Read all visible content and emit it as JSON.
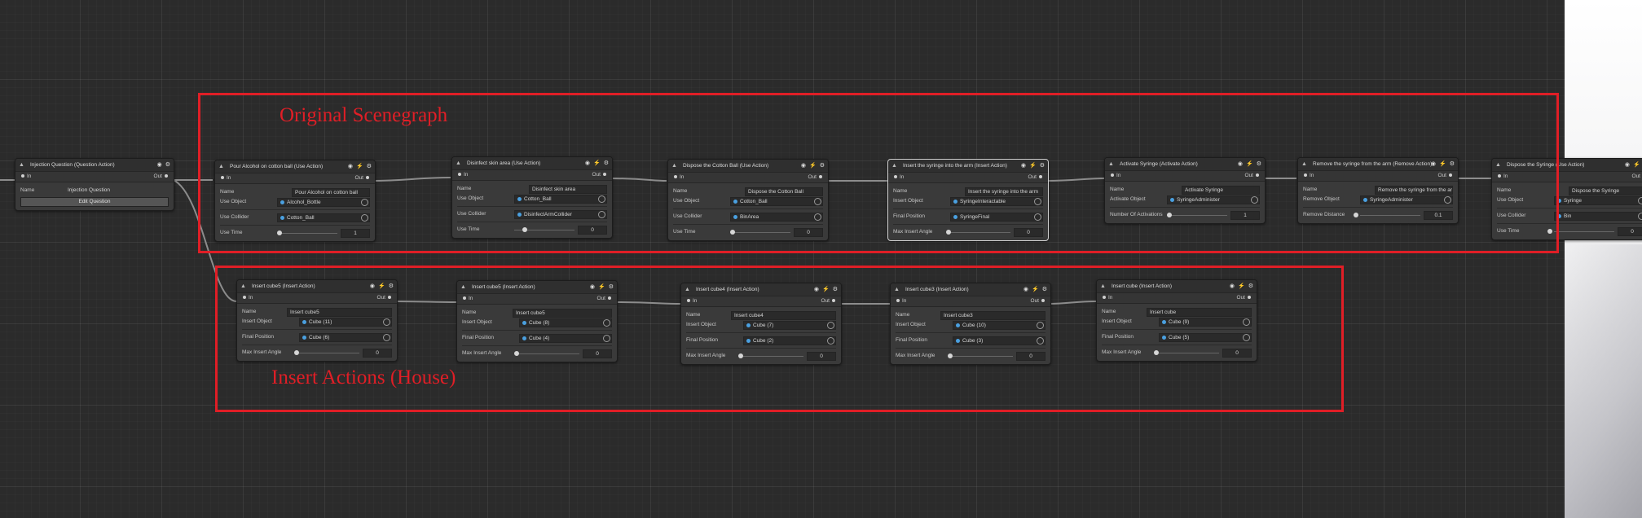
{
  "colors": {
    "annotation": "#e01e26",
    "canvas": "#2b2b2b",
    "bolt": "#f08a24",
    "object_dot": "#4aa0e0"
  },
  "annotations": {
    "original": "Original Scenegraph",
    "insert": "Insert Actions (House)"
  },
  "icons": {
    "collapse": "▲",
    "eye": "◉",
    "bolt": "⚡",
    "gear": "⚙"
  },
  "ports": {
    "in": "In",
    "out": "Out"
  },
  "nodes": [
    {
      "title": "Injection Question (Question Action)",
      "rows": [
        [
          "Name",
          "Injection Question"
        ]
      ],
      "button": "Edit Question"
    },
    {
      "title": "Pour Alcohol on cotton ball (Use Action)",
      "rows": [
        [
          "Name",
          "Pour Alcohol on cotton ball"
        ],
        [
          "Use Object",
          "Alcohol_Bottle"
        ],
        [
          "Use Collider",
          "Cotton_Ball"
        ],
        [
          "Use Time",
          "1"
        ]
      ]
    },
    {
      "title": "Disinfect skin area (Use Action)",
      "rows": [
        [
          "Name",
          "Disinfect skin area"
        ],
        [
          "Use Object",
          "Cotton_Ball"
        ],
        [
          "Use Collider",
          "DisinfectArmCollider"
        ],
        [
          "Use Time",
          "0"
        ]
      ]
    },
    {
      "title": "Dispose the Cotton Ball (Use Action)",
      "rows": [
        [
          "Name",
          "Dispose the Cotton Ball"
        ],
        [
          "Use Object",
          "Cotton_Ball"
        ],
        [
          "Use Collider",
          "BinArea"
        ],
        [
          "Use Time",
          "0"
        ]
      ]
    },
    {
      "title": "Insert the syringe into the arm (Insert Action)",
      "rows": [
        [
          "Name",
          "Insert the syringe into the arm"
        ],
        [
          "Insert Object",
          "SyringeInteractable"
        ],
        [
          "Final Position",
          "SyringeFinal"
        ],
        [
          "Max Insert Angle",
          "0"
        ]
      ]
    },
    {
      "title": "Activate Syringe (Activate Action)",
      "rows": [
        [
          "Name",
          "Activate Syringe"
        ],
        [
          "Activate Object",
          "SyringeAdminister"
        ],
        [
          "Number Of Activations",
          "1"
        ]
      ]
    },
    {
      "title": "Remove the syringe from the arm (Remove Action)",
      "rows": [
        [
          "Name",
          "Remove the syringe from the arm"
        ],
        [
          "Remove Object",
          "SyringeAdminister"
        ],
        [
          "Remove Distance",
          "0.1"
        ]
      ]
    },
    {
      "title": "Dispose the Syringe (Use Action)",
      "rows": [
        [
          "Name",
          "Dispose the Syringe"
        ],
        [
          "Use Object",
          "Syringe"
        ],
        [
          "Use Collider",
          "Bin"
        ],
        [
          "Use Time",
          "0"
        ]
      ]
    },
    {
      "title": "Insert cube5 (Insert Action)",
      "rows": [
        [
          "Name",
          "Insert cube5"
        ],
        [
          "Insert Object",
          "Cube (11)"
        ],
        [
          "Final Position",
          "Cube (6)"
        ],
        [
          "Max Insert Angle",
          "0"
        ]
      ]
    },
    {
      "title": "Insert cube5 (Insert Action)",
      "rows": [
        [
          "Name",
          "Insert cube5"
        ],
        [
          "Insert Object",
          "Cube (8)"
        ],
        [
          "Final Position",
          "Cube (4)"
        ],
        [
          "Max Insert Angle",
          "0"
        ]
      ]
    },
    {
      "title": "Insert cube4 (Insert Action)",
      "rows": [
        [
          "Name",
          "Insert cube4"
        ],
        [
          "Insert Object",
          "Cube (7)"
        ],
        [
          "Final Position",
          "Cube (2)"
        ],
        [
          "Max Insert Angle",
          "0"
        ]
      ]
    },
    {
      "title": "Insert cube3 (Insert Action)",
      "rows": [
        [
          "Name",
          "Insert cube3"
        ],
        [
          "Insert Object",
          "Cube (10)"
        ],
        [
          "Final Position",
          "Cube (3)"
        ],
        [
          "Max Insert Angle",
          "0"
        ]
      ]
    },
    {
      "title": "Insert cube (Insert Action)",
      "rows": [
        [
          "Name",
          "Insert cube"
        ],
        [
          "Insert Object",
          "Cube (9)"
        ],
        [
          "Final Position",
          "Cube (5)"
        ],
        [
          "Max Insert Angle",
          "0"
        ]
      ]
    }
  ]
}
